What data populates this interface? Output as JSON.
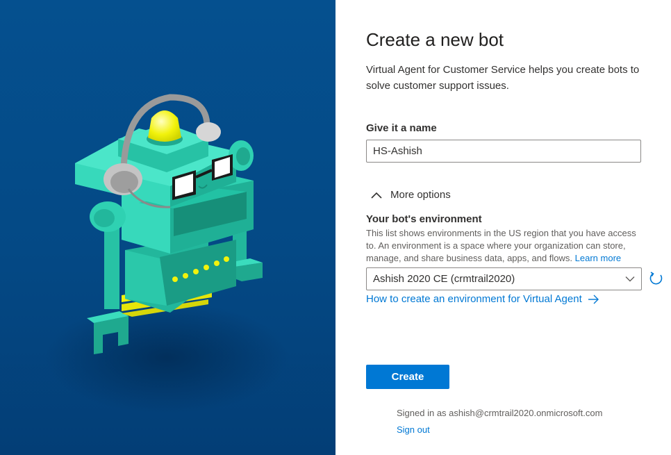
{
  "form": {
    "title": "Create a new bot",
    "subtitle": "Virtual Agent for Customer Service helps you create bots to solve customer support issues.",
    "name_label": "Give it a name",
    "name_value": "HS-Ashish",
    "more_options_label": "More options",
    "environment_label": "Your bot's environment",
    "environment_description": "This list shows environments in the US region that you have access to. An environment is a space where your organization can store, manage, and share business data, apps, and flows.",
    "learn_more_label": "Learn more",
    "environment_selected": "Ashish 2020 CE (crmtrail2020)",
    "howto_link_label": "How to create an environment for Virtual Agent",
    "create_button_label": "Create",
    "signed_in_text": "Signed in as ashish@crmtrail2020.onmicrosoft.com",
    "sign_out_label": "Sign out"
  },
  "icons": {
    "more_options": "chevron-up-icon",
    "dropdown": "chevron-down-icon",
    "refresh": "refresh-icon",
    "howto_arrow": "arrow-right-icon"
  },
  "colors": {
    "hero_background": "#044985",
    "accent": "#0078d4",
    "robot_body": "#2fd1b2",
    "robot_yellow": "#f2f20c"
  }
}
